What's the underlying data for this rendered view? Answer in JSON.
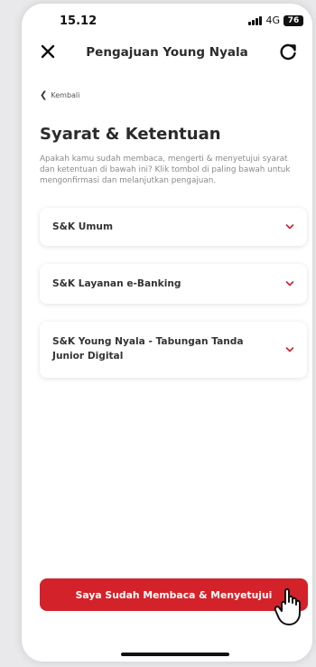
{
  "status_bar": {
    "time": "15.12",
    "network": "4G",
    "battery": "76"
  },
  "header": {
    "title": "Pengajuan Young Nyala",
    "close_icon": "close-icon",
    "refresh_icon": "refresh-icon"
  },
  "back": {
    "label": "Kembali"
  },
  "content": {
    "title": "Syarat & Ketentuan",
    "description": "Apakah kamu sudah membaca, mengerti & menyetujui syarat dan ketentuan di bawah ini? Klik tombol di paling bawah untuk mengonfirmasi dan melanjutkan pengajuan."
  },
  "terms": [
    {
      "label": "S&K Umum"
    },
    {
      "label": "S&K Layanan e-Banking"
    },
    {
      "label": "S&K Young Nyala - Tabungan Tanda Junior Digital"
    }
  ],
  "cta": {
    "label": "Saya Sudah Membaca & Menyetujui"
  },
  "colors": {
    "accent": "#d32229",
    "text": "#2b2b2b",
    "muted": "#8a8a8a"
  }
}
